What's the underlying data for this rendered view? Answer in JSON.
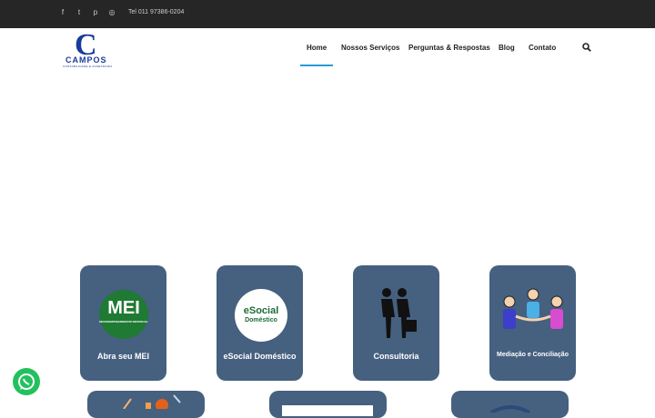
{
  "topbar": {
    "social": [
      {
        "name": "facebook-icon",
        "glyph": "f"
      },
      {
        "name": "twitter-icon",
        "glyph": "t"
      },
      {
        "name": "pinterest-icon",
        "glyph": "p"
      },
      {
        "name": "instagram-icon",
        "glyph": "◎"
      }
    ],
    "phone": "Tel 011 97386-0204"
  },
  "logo": {
    "mark": "C",
    "word": "CAMPOS",
    "tagline": "CONTABILIDADE E ASSESSORIA"
  },
  "nav": {
    "items": [
      "Home",
      "Nossos Serviços",
      "Perguntas & Respostas",
      "Blog",
      "Contato"
    ],
    "active": "Home"
  },
  "services": [
    {
      "label": "Abra seu MEI",
      "badge": "MEI",
      "badge_sub": "MICROEMPREENDEDOR INDIVIDUAL"
    },
    {
      "label": "eSocial Doméstico",
      "badge": "eSocial",
      "badge_sub": "Doméstico"
    },
    {
      "label": "Consultoria"
    },
    {
      "label": "Mediação e Conciliação"
    }
  ],
  "colors": {
    "topbar": "#262626",
    "card": "#46607f",
    "accent": "#2a9bd6",
    "brand": "#1a3a9b",
    "whatsapp": "#22c15e"
  }
}
